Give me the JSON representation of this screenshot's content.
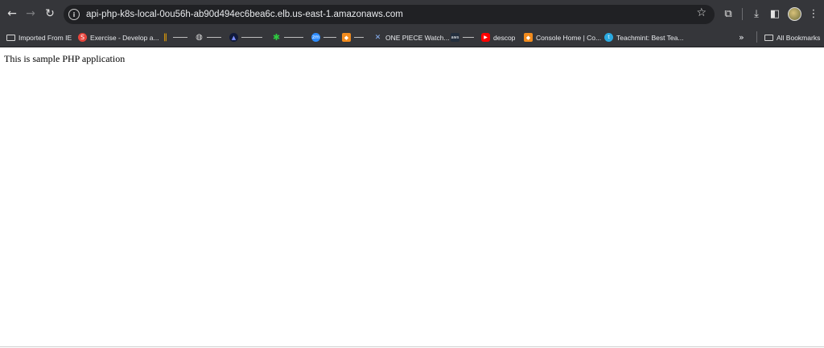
{
  "browser": {
    "url": "api-php-k8s-local-0ou56h-ab90d494ec6bea6c.elb.us-east-1.amazonaws.com",
    "icons": {
      "back": "←",
      "forward": "→",
      "reload": "↻",
      "site_info": "i",
      "bookmark_star": "☆",
      "extensions": "⧉",
      "download": "⤓",
      "side_panel": "◧",
      "menu": "⋮",
      "more_bookmarks": "»"
    }
  },
  "bookmarks": {
    "items": [
      {
        "label": "Imported From IE",
        "icon": "folder-icon"
      },
      {
        "label": "Exercise - Develop a...",
        "icon": "learn-icon",
        "color": "#e8453c"
      },
      {
        "label": "",
        "icon": "analytics-icon",
        "color": "#f9ab00"
      },
      {
        "label": "",
        "icon": "globe-icon",
        "color": "#d8d8d8"
      },
      {
        "label": "",
        "icon": "triangle-icon",
        "color": "#4a66ff"
      },
      {
        "label": "",
        "icon": "sparkle-icon",
        "color": "#2ecc40"
      },
      {
        "label": "",
        "icon": "zoom-icon",
        "color": "#2d8cff"
      },
      {
        "label": "",
        "icon": "box-icon",
        "color": "#f28b1d"
      },
      {
        "label": "ONE PIECE Watch...",
        "icon": "pirate-icon",
        "color": "#8ab4f8"
      },
      {
        "label": "",
        "icon": "aws-icon",
        "color": "#ffffff"
      },
      {
        "label": "descop",
        "icon": "youtube-icon",
        "color": "#ff0000"
      },
      {
        "label": "Console Home | Co...",
        "icon": "aws-console-icon",
        "color": "#f28b1d"
      },
      {
        "label": "Teachmint: Best Tea...",
        "icon": "teachmint-icon",
        "color": "#2aa9e0"
      }
    ],
    "all_bookmarks_label": "All Bookmarks"
  },
  "page": {
    "body_text": "This is sample PHP application"
  }
}
